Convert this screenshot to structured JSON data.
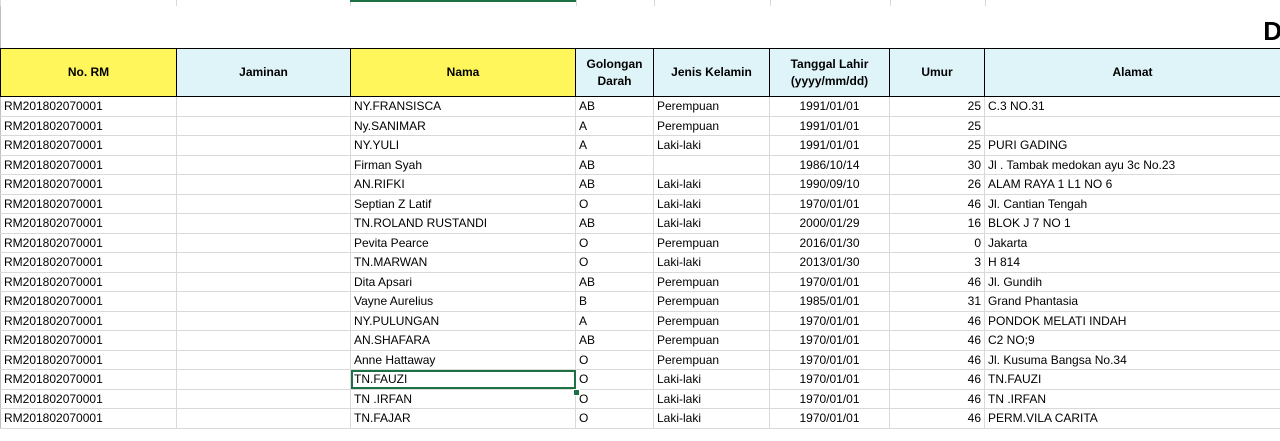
{
  "title_fragment": "D",
  "headers": {
    "no_rm": "No. RM",
    "jaminan": "Jaminan",
    "nama": "Nama",
    "golongan_darah_1": "Golongan",
    "golongan_darah_2": "Darah",
    "jenis_kelamin": "Jenis Kelamin",
    "tanggal_lahir_1": "Tanggal Lahir",
    "tanggal_lahir_2": "(yyyy/mm/dd)",
    "umur": "Umur",
    "alamat": "Alamat"
  },
  "rows": [
    {
      "no_rm": "RM201802070001",
      "jaminan": "",
      "nama": "NY.FRANSISCA",
      "gol": "AB",
      "jk": "Perempuan",
      "tgl": "1991/01/01",
      "umur": "25",
      "alamat": "C.3 NO.31"
    },
    {
      "no_rm": "RM201802070001",
      "jaminan": "",
      "nama": "Ny.SANIMAR",
      "gol": "A",
      "jk": "Perempuan",
      "tgl": "1991/01/01",
      "umur": "25",
      "alamat": ""
    },
    {
      "no_rm": "RM201802070001",
      "jaminan": "",
      "nama": "NY.YULI",
      "gol": "A",
      "jk": "Laki-laki",
      "tgl": "1991/01/01",
      "umur": "25",
      "alamat": "PURI GADING"
    },
    {
      "no_rm": "RM201802070001",
      "jaminan": "",
      "nama": "Firman Syah",
      "gol": "AB",
      "jk": "",
      "tgl": "1986/10/14",
      "umur": "30",
      "alamat": "Jl . Tambak medokan ayu 3c No.23"
    },
    {
      "no_rm": "RM201802070001",
      "jaminan": "",
      "nama": "AN.RIFKI",
      "gol": "AB",
      "jk": "Laki-laki",
      "tgl": "1990/09/10",
      "umur": "26",
      "alamat": "ALAM RAYA 1 L1 NO 6"
    },
    {
      "no_rm": "RM201802070001",
      "jaminan": "",
      "nama": "Septian Z Latif",
      "gol": "O",
      "jk": "Laki-laki",
      "tgl": "1970/01/01",
      "umur": "46",
      "alamat": "Jl. Cantian Tengah"
    },
    {
      "no_rm": "RM201802070001",
      "jaminan": "",
      "nama": "TN.ROLAND RUSTANDI",
      "gol": "AB",
      "jk": "Laki-laki",
      "tgl": "2000/01/29",
      "umur": "16",
      "alamat": "BLOK J 7 NO 1"
    },
    {
      "no_rm": "RM201802070001",
      "jaminan": "",
      "nama": "Pevita Pearce",
      "gol": "O",
      "jk": "Perempuan",
      "tgl": "2016/01/30",
      "umur": "0",
      "alamat": "Jakarta"
    },
    {
      "no_rm": "RM201802070001",
      "jaminan": "",
      "nama": "TN.MARWAN",
      "gol": "O",
      "jk": "Laki-laki",
      "tgl": "2013/01/30",
      "umur": "3",
      "alamat": "H 814"
    },
    {
      "no_rm": "RM201802070001",
      "jaminan": "",
      "nama": "Dita Apsari",
      "gol": "AB",
      "jk": "Perempuan",
      "tgl": "1970/01/01",
      "umur": "46",
      "alamat": "Jl. Gundih"
    },
    {
      "no_rm": "RM201802070001",
      "jaminan": "",
      "nama": "Vayne Aurelius",
      "gol": "B",
      "jk": "Perempuan",
      "tgl": "1985/01/01",
      "umur": "31",
      "alamat": "Grand Phantasia"
    },
    {
      "no_rm": "RM201802070001",
      "jaminan": "",
      "nama": "NY.PULUNGAN",
      "gol": "A",
      "jk": "Perempuan",
      "tgl": "1970/01/01",
      "umur": "46",
      "alamat": "PONDOK MELATI INDAH"
    },
    {
      "no_rm": "RM201802070001",
      "jaminan": "",
      "nama": "AN.SHAFARA",
      "gol": "AB",
      "jk": "Perempuan",
      "tgl": "1970/01/01",
      "umur": "46",
      "alamat": "C2 NO;9"
    },
    {
      "no_rm": "RM201802070001",
      "jaminan": "",
      "nama": "Anne Hattaway",
      "gol": "O",
      "jk": "Perempuan",
      "tgl": "1970/01/01",
      "umur": "46",
      "alamat": "Jl. Kusuma Bangsa No.34"
    },
    {
      "no_rm": "RM201802070001",
      "jaminan": "",
      "nama": "TN.FAUZI",
      "gol": "O",
      "jk": "Laki-laki",
      "tgl": "1970/01/01",
      "umur": "46",
      "alamat": "TN.FAUZI"
    },
    {
      "no_rm": "RM201802070001",
      "jaminan": "",
      "nama": "TN .IRFAN",
      "gol": "O",
      "jk": "Laki-laki",
      "tgl": "1970/01/01",
      "umur": "46",
      "alamat": "TN .IRFAN"
    },
    {
      "no_rm": "RM201802070001",
      "jaminan": "",
      "nama": "TN.FAJAR",
      "gol": "O",
      "jk": "Laki-laki",
      "tgl": "1970/01/01",
      "umur": "46",
      "alamat": "PERM.VILA CARITA"
    }
  ],
  "colors": {
    "header_yellow": "#fef65b",
    "header_cyan": "#dff4f9",
    "selection_green": "#1e7145",
    "gridline": "#d9d9d9"
  },
  "active_cell": {
    "row": 15,
    "column": "Nama"
  }
}
